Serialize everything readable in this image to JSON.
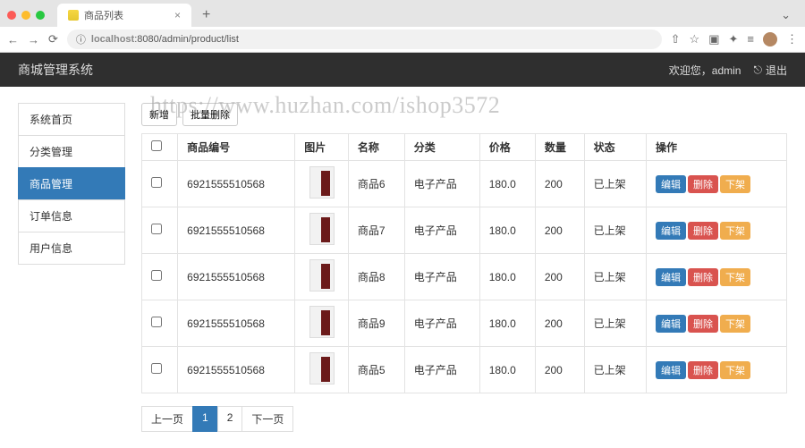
{
  "browser": {
    "tab_title": "商品列表",
    "url_host": "localhost",
    "url_rest": ":8080/admin/product/list"
  },
  "header": {
    "brand": "商城管理系统",
    "welcome": "欢迎您，admin",
    "logout": "退出"
  },
  "sidebar": {
    "items": [
      {
        "label": "系统首页",
        "active": false
      },
      {
        "label": "分类管理",
        "active": false
      },
      {
        "label": "商品管理",
        "active": true
      },
      {
        "label": "订单信息",
        "active": false
      },
      {
        "label": "用户信息",
        "active": false
      }
    ]
  },
  "watermark": "https://www.huzhan.com/ishop3572",
  "toolbar": {
    "add": "新增",
    "bulk_delete": "批量删除"
  },
  "table": {
    "headers": [
      "",
      "商品编号",
      "图片",
      "名称",
      "分类",
      "价格",
      "数量",
      "状态",
      "操作"
    ],
    "actions": {
      "edit": "编辑",
      "delete": "删除",
      "off_shelf": "下架"
    },
    "rows": [
      {
        "code": "6921555510568",
        "name": "商品6",
        "category": "电子产品",
        "price": "180.0",
        "qty": "200",
        "status": "已上架"
      },
      {
        "code": "6921555510568",
        "name": "商品7",
        "category": "电子产品",
        "price": "180.0",
        "qty": "200",
        "status": "已上架"
      },
      {
        "code": "6921555510568",
        "name": "商品8",
        "category": "电子产品",
        "price": "180.0",
        "qty": "200",
        "status": "已上架"
      },
      {
        "code": "6921555510568",
        "name": "商品9",
        "category": "电子产品",
        "price": "180.0",
        "qty": "200",
        "status": "已上架"
      },
      {
        "code": "6921555510568",
        "name": "商品5",
        "category": "电子产品",
        "price": "180.0",
        "qty": "200",
        "status": "已上架"
      }
    ]
  },
  "pagination": {
    "prev": "上一页",
    "next": "下一页",
    "pages": [
      "1",
      "2"
    ],
    "current": "1"
  }
}
